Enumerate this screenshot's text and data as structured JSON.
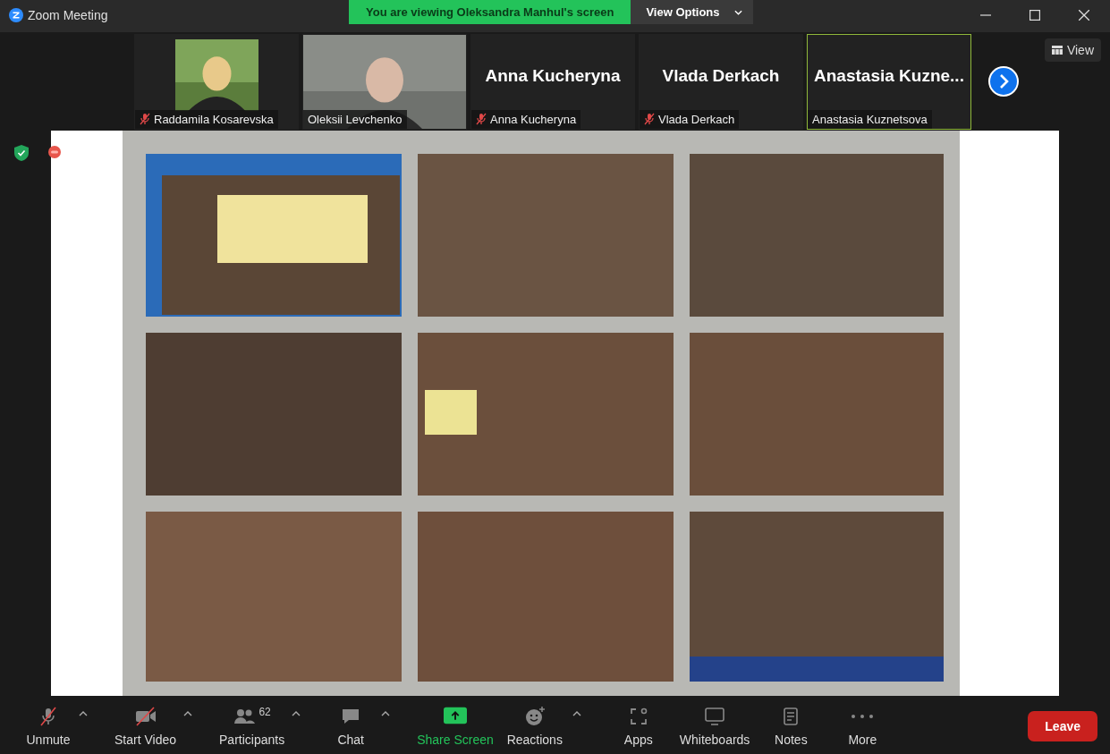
{
  "window": {
    "title": "Zoom Meeting"
  },
  "banner": {
    "text": "You are viewing Oleksandra Manhul's screen",
    "options": "View Options"
  },
  "view_button": "View",
  "tiles": [
    {
      "kind": "video",
      "name": "Raddamila Kosarevska",
      "muted": true,
      "selected": false
    },
    {
      "kind": "video",
      "name": "Oleksii Levchenko",
      "muted": false,
      "selected": false
    },
    {
      "kind": "name",
      "title": "Anna Kucheryna",
      "name": "Anna Kucheryna",
      "muted": true,
      "selected": false
    },
    {
      "kind": "name",
      "title": "Vlada Derkach",
      "name": "Vlada Derkach",
      "muted": true,
      "selected": false
    },
    {
      "kind": "name",
      "title": "Anastasia  Kuzne...",
      "name": "Anastasia Kuznetsova",
      "muted": false,
      "selected": true
    }
  ],
  "toolbar": [
    {
      "kind": "mic",
      "label": "Unmute",
      "caret": true
    },
    {
      "kind": "video",
      "label": "Start Video",
      "caret": true
    },
    {
      "kind": "participants",
      "label": "Participants",
      "count": "62",
      "caret": true
    },
    {
      "kind": "chat",
      "label": "Chat",
      "caret": true
    },
    {
      "kind": "share",
      "label": "Share Screen",
      "caret": false
    },
    {
      "kind": "reactions",
      "label": "Reactions",
      "caret": true
    },
    {
      "kind": "apps",
      "label": "Apps",
      "caret": false
    },
    {
      "kind": "whiteboards",
      "label": "Whiteboards",
      "caret": false
    },
    {
      "kind": "notes",
      "label": "Notes",
      "caret": false
    },
    {
      "kind": "more",
      "label": "More",
      "caret": false
    }
  ],
  "leave": "Leave"
}
